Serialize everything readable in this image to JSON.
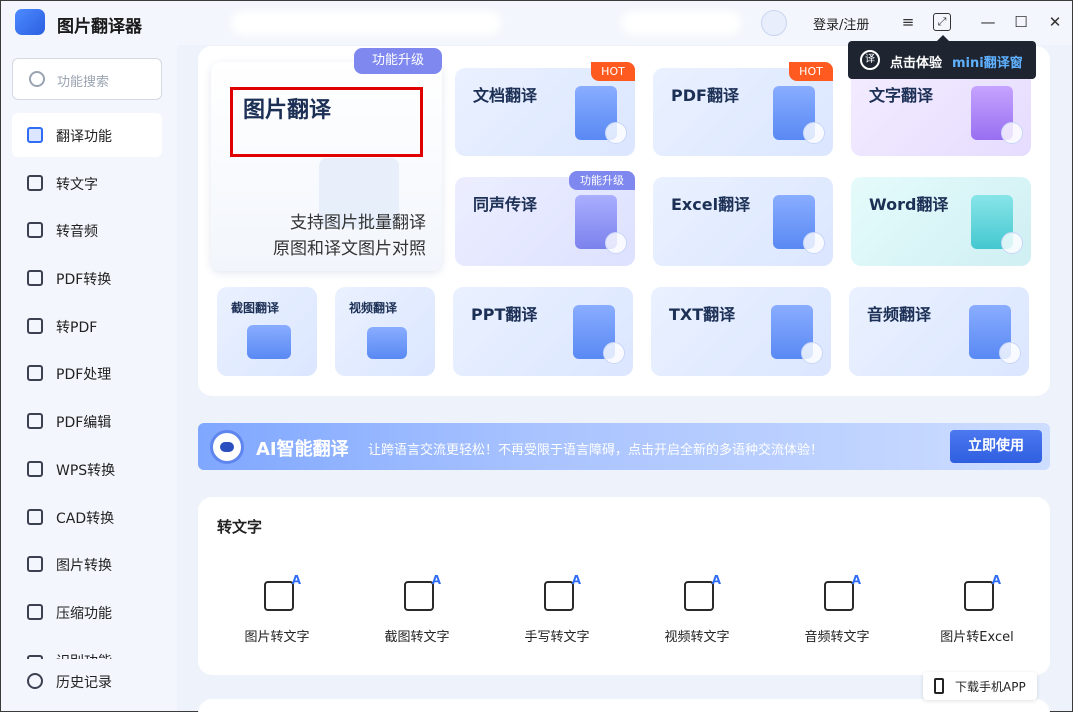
{
  "titlebar": {
    "app_title": "图片翻译器",
    "login": "登录/注册",
    "menu_icon": "≡",
    "pin_icon": "⤢",
    "min_icon": "—",
    "max_icon": "☐",
    "close_icon": "✕"
  },
  "tooltip": {
    "icon": "译",
    "text": "点击体验",
    "highlight": "mini翻译窗"
  },
  "sidebar": {
    "search_placeholder": "功能搜索",
    "items": [
      {
        "label": "翻译功能"
      },
      {
        "label": "转文字"
      },
      {
        "label": "转音频"
      },
      {
        "label": "PDF转换"
      },
      {
        "label": "转PDF"
      },
      {
        "label": "PDF处理"
      },
      {
        "label": "PDF编辑"
      },
      {
        "label": "WPS转换"
      },
      {
        "label": "CAD转换"
      },
      {
        "label": "图片转换"
      },
      {
        "label": "压缩功能"
      },
      {
        "label": "识别功能"
      },
      {
        "label": "历史记录"
      }
    ]
  },
  "main": {
    "featured": {
      "badge": "功能升级",
      "title": "图片翻译",
      "desc1": "支持图片批量翻译",
      "desc2": "原图和译文图片对照"
    },
    "tiles": [
      {
        "label": "文档翻译",
        "badge": "HOT",
        "accent": "#4a7ef2"
      },
      {
        "label": "PDF翻译",
        "badge": "HOT",
        "accent": "#4a7ef2"
      },
      {
        "label": "文字翻译",
        "badge": "",
        "accent": "#9d6bf0"
      },
      {
        "label": "同声传译",
        "badge": "功能升级",
        "accent": "#7e88ee"
      },
      {
        "label": "Excel翻译",
        "badge": "",
        "accent": "#4a7ef2"
      },
      {
        "label": "Word翻译",
        "badge": "",
        "accent": "#2cc2c9"
      },
      {
        "label": "截图翻译",
        "badge": "",
        "accent": "#4a7ef2"
      },
      {
        "label": "视频翻译",
        "badge": "",
        "accent": "#4a7ef2"
      },
      {
        "label": "PPT翻译",
        "badge": "",
        "accent": "#4a7ef2"
      },
      {
        "label": "TXT翻译",
        "badge": "",
        "accent": "#4a7ef2"
      },
      {
        "label": "音频翻译",
        "badge": "",
        "accent": "#4a7ef2"
      }
    ],
    "banner": {
      "title": "AI智能翻译",
      "text": "让跨语言交流更轻松！不再受限于语言障碍，点击开启全新的多语种交流体验！",
      "button": "立即使用"
    },
    "section": {
      "title": "转文字",
      "tools": [
        "图片转文字",
        "截图转文字",
        "手写转文字",
        "视频转文字",
        "音频转文字",
        "图片转Excel"
      ]
    },
    "download": "下载手机APP"
  }
}
